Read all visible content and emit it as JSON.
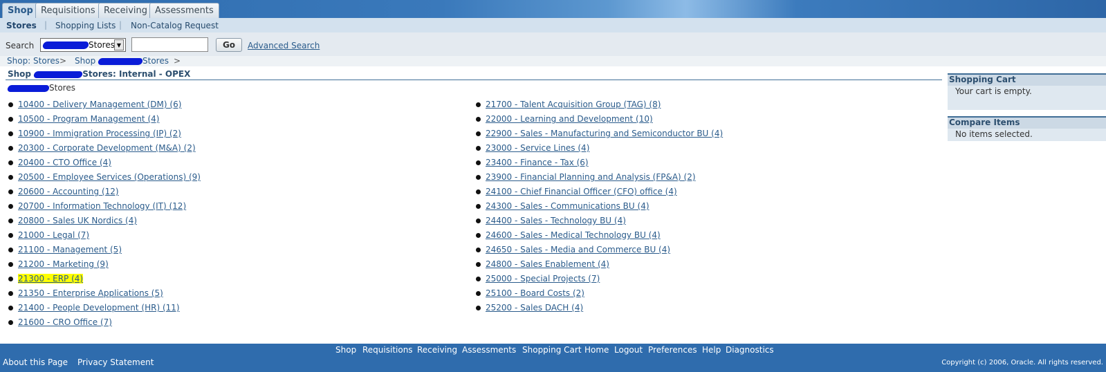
{
  "tabs": [
    "Shop",
    "Requisitions",
    "Receiving",
    "Assessments"
  ],
  "subnav": [
    "Stores",
    "Shopping Lists",
    "Non-Catalog Request"
  ],
  "search": {
    "label": "Search",
    "select_value": "Stores",
    "text_value": "",
    "go_label": "Go",
    "advanced_label": "Advanced Search"
  },
  "breadcrumb": {
    "first": "Shop: Stores",
    "second_prefix": "Shop",
    "second_suffix": "Stores",
    "separator": ">"
  },
  "page": {
    "title_prefix": "Shop",
    "title_suffix": "Stores: Internal - OPEX",
    "subheading": "Stores"
  },
  "stores_left": [
    "10400 - Delivery Management (DM) (6)",
    "10500 - Program Management (4)",
    "10900 - Immigration Processing (IP) (2)",
    "20300 - Corporate Development (M&A) (2)",
    "20400 - CTO Office (4)",
    "20500 - Employee Services (Operations) (9)",
    "20600 - Accounting (12)",
    "20700 - Information Technology (IT) (12)",
    "20800 - Sales UK Nordics (4)",
    "21000 - Legal (7)",
    "21100 - Management (5)",
    "21200 - Marketing (9)",
    "21300 - ERP (4)",
    "21350 - Enterprise Applications (5)",
    "21400 - People Development (HR) (11)",
    "21600 - CRO Office (7)"
  ],
  "stores_right": [
    "21700 - Talent Acquisition Group (TAG) (8)",
    "22000 - Learning and Development (10)",
    "22900 - Sales - Manufacturing and Semiconductor BU (4)",
    "23000 - Service Lines (4)",
    "23400 - Finance - Tax (6)",
    "23900 - Financial Planning and Analysis (FP&A) (2)",
    "24100 - Chief Financial Officer (CFO) office (4)",
    "24300 - Sales - Communications BU (4)",
    "24400 - Sales - Technology BU (4)",
    "24600 - Sales - Medical Technology BU (4)",
    "24650 - Sales - Media and Commerce BU (4)",
    "24800 - Sales Enablement (4)",
    "25000 - Special Projects (7)",
    "25100 - Board Costs (2)",
    "25200 - Sales DACH (4)"
  ],
  "highlighted_store": "21300 - ERP (4)",
  "cart": {
    "title": "Shopping Cart",
    "body": "Your cart is empty."
  },
  "compare": {
    "title": "Compare Items",
    "body": "No items selected."
  },
  "footer": {
    "nav": [
      "Shop",
      "Requisitions",
      "Receiving",
      "Assessments",
      "Shopping Cart",
      "Home",
      "Logout",
      "Preferences",
      "Help",
      "Diagnostics"
    ],
    "about": "About this Page",
    "privacy": "Privacy Statement",
    "copyright": "Copyright (c) 2006, Oracle. All rights reserved."
  },
  "colors": {
    "brand_blue": "#2f6cad",
    "link": "#2a5b8b",
    "highlight": "#ffff00",
    "redaction": "#0a1cd8"
  }
}
